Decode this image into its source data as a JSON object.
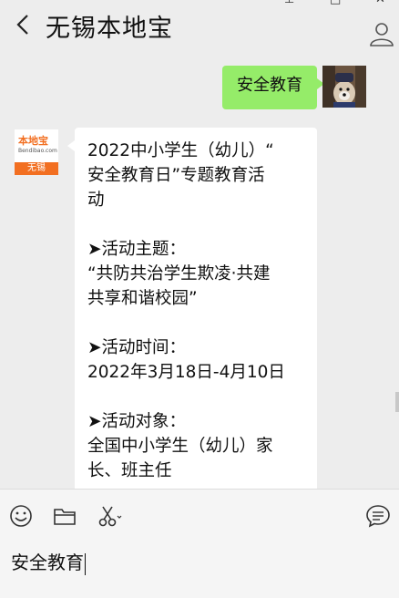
{
  "header": {
    "title": "无锡本地宝"
  },
  "messages": {
    "sent_text": "安全教育",
    "received_lines": [
      "2022中小学生（幼儿）“",
      "安全教育日”专题教育活",
      "动",
      "",
      "➤活动主题：",
      "“共防共治学生欺凌·共建",
      "共享和谐校园”",
      "",
      "➤活动时间：",
      "2022年3月18日-4月10日",
      "",
      "➤活动对象：",
      "全国中小学生（幼儿）家",
      "长、班主任"
    ]
  },
  "logo": {
    "brand": "本地宝",
    "brand_sub": "Bendibao.com",
    "city": "无锡"
  },
  "input": {
    "value": "安全教育"
  },
  "colors": {
    "sent_bubble": "#95ec69",
    "received_bubble": "#ffffff",
    "brand_orange": "#f26f21",
    "background": "#ededed"
  },
  "icons": [
    "back-icon",
    "user-icon",
    "emoji-icon",
    "folder-icon",
    "scissors-icon",
    "chat-history-icon"
  ]
}
